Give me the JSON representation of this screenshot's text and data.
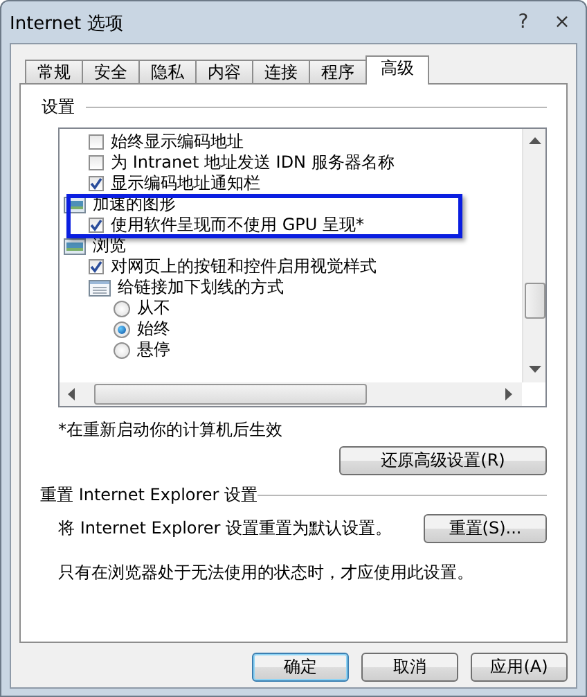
{
  "window": {
    "title": "Internet 选项",
    "help_button": "?",
    "close_button": "×"
  },
  "tabs": [
    {
      "label": "常规",
      "selected": false
    },
    {
      "label": "安全",
      "selected": false
    },
    {
      "label": "隐私",
      "selected": false
    },
    {
      "label": "内容",
      "selected": false
    },
    {
      "label": "连接",
      "selected": false
    },
    {
      "label": "程序",
      "selected": false
    },
    {
      "label": "高级",
      "selected": true
    }
  ],
  "settings": {
    "title": "设置",
    "items": [
      {
        "kind": "checkbox",
        "label": "始终显示编码地址",
        "checked": false
      },
      {
        "kind": "checkbox",
        "label": "为 Intranet 地址发送 IDN 服务器名称",
        "checked": false
      },
      {
        "kind": "checkbox",
        "label": "显示编码地址通知栏",
        "checked": true
      },
      {
        "kind": "group",
        "label": "加速的图形",
        "children": [
          {
            "kind": "checkbox",
            "label": "使用软件呈现而不使用 GPU 呈现*",
            "checked": true
          }
        ]
      },
      {
        "kind": "group",
        "label": "浏览",
        "children": [
          {
            "kind": "checkbox",
            "label": "对网页上的按钮和控件启用视觉样式",
            "checked": true
          },
          {
            "kind": "option_group",
            "label": "给链接加下划线的方式",
            "children": [
              {
                "kind": "radio",
                "label": "从不",
                "selected": false
              },
              {
                "kind": "radio",
                "label": "始终",
                "selected": true
              },
              {
                "kind": "radio",
                "label": "悬停",
                "selected": false
              }
            ]
          }
        ]
      }
    ],
    "note": "*在重新启动你的计算机后生效",
    "restore_button": "还原高级设置(R)"
  },
  "reset": {
    "title": "重置 Internet Explorer 设置",
    "description": "将 Internet Explorer 设置重置为默认设置。",
    "button": "重置(S)...",
    "warning": "只有在浏览器处于无法使用的状态时，才应使用此设置。"
  },
  "buttons": [
    {
      "label": "确定",
      "default": true
    },
    {
      "label": "取消",
      "default": false
    },
    {
      "label": "应用(A)",
      "default": false
    }
  ]
}
